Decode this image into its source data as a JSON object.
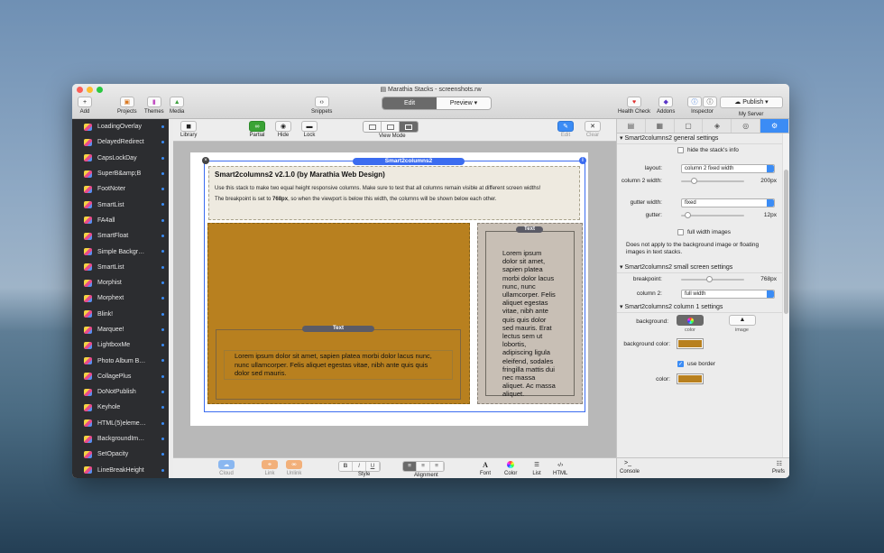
{
  "window": {
    "title": "Marathia Stacks - screenshots.rw"
  },
  "toolbar": {
    "add": "Add",
    "projects": "Projects",
    "themes": "Themes",
    "media": "Media",
    "snippets": "Snippets",
    "edit_tab": "Edit",
    "preview_tab": "Preview",
    "health_check": "Health Check",
    "addons": "Addons",
    "inspector": "Inspector",
    "publish": "Publish",
    "my_server": "My Server"
  },
  "sidebar": {
    "items": [
      {
        "label": "LoadingOverlay"
      },
      {
        "label": "DelayedRedirect"
      },
      {
        "label": "CapsLockDay"
      },
      {
        "label": "SuperB&amp;B"
      },
      {
        "label": "FootNoter"
      },
      {
        "label": "SmartList"
      },
      {
        "label": "FA4all"
      },
      {
        "label": "SmartFloat"
      },
      {
        "label": "Simple Backgr…"
      },
      {
        "label": "SmartList"
      },
      {
        "label": "Morphist"
      },
      {
        "label": "Morphext"
      },
      {
        "label": "Blink!"
      },
      {
        "label": "Marquee!"
      },
      {
        "label": "LightboxMe"
      },
      {
        "label": "Photo Album B…"
      },
      {
        "label": "CollagePlus"
      },
      {
        "label": "DoNotPublish"
      },
      {
        "label": "Keyhole"
      },
      {
        "label": "HTML(5)eleme…"
      },
      {
        "label": "BackgroundIm…"
      },
      {
        "label": "SetOpacity"
      },
      {
        "label": "LineBreakHeight"
      }
    ]
  },
  "stacks_toolbar": {
    "library": "Library",
    "partial": "Partial",
    "hide": "Hide",
    "lock": "Lock",
    "view_mode": "View Mode",
    "edit": "Edit",
    "clear": "Clear"
  },
  "editor": {
    "stack_name": "Smart2columns2",
    "info_title": "Smart2columns2 v2.1.0 (by Marathia Web Design)",
    "info_line1": "Use this stack to make two equal height responsive columns. Make sure to test that all columns remain visible at different screen widths!",
    "info_line2_pre": "The breakpoint is set to ",
    "info_line2_bold": "768px",
    "info_line2_post": ", so when the viewport is below this width, the columns will be shown below each other.",
    "text_label": "Text",
    "lorem_short": "Lorem ipsum dolor sit amet, sapien platea morbi dolor lacus nunc, nunc ullamcorper. Felis aliquet egestas vitae, nibh ante quis quis dolor sed mauris.",
    "lorem_long": "Lorem ipsum dolor sit amet, sapien platea morbi dolor lacus nunc, nunc ullamcorper. Felis aliquet egestas vitae, nibh ante quis quis dolor sed mauris. Erat lectus sem ut lobortis, adipiscing ligula eleifend, sodales fringilla mattis dui nec massa aliquet. Ac massa aliquet."
  },
  "bottombar": {
    "cloud": "Cloud",
    "link": "Link",
    "unlink": "Unlink",
    "bold": "B",
    "italic": "I",
    "underline": "U",
    "style": "Style",
    "alignment": "Alignment",
    "font": "Font",
    "color": "Color",
    "list": "List",
    "html": "HTML",
    "console": "Console",
    "prefs": "Prefs"
  },
  "inspector_panel": {
    "section1": "Smart2columns2 general settings",
    "hide_info": "hide the stack's info",
    "layout_label": "layout:",
    "layout_value": "column 2 fixed width",
    "col2width_label": "column 2 width:",
    "col2width_value": "200px",
    "col2width_fraction": 0.15,
    "gutter_width_label": "gutter width:",
    "gutter_width_value": "fixed",
    "gutter_label": "gutter:",
    "gutter_value": "12px",
    "gutter_fraction": 0.05,
    "full_width_images": "full width images",
    "note": "Does not apply to the background image or floating images in text stacks.",
    "section2": "Smart2columns2 small screen settings",
    "breakpoint_label": "breakpoint:",
    "breakpoint_value": "768px",
    "breakpoint_fraction": 0.4,
    "column2_label": "column 2:",
    "column2_value": "full width",
    "section3": "Smart2columns2 column 1 settings",
    "background_label": "background:",
    "color_opt": "color",
    "image_opt": "image",
    "bg_color_label": "background color:",
    "use_border": "use border",
    "color_label": "color:",
    "swatch_color": "#b8801f",
    "accent": "#3b8cf5"
  }
}
